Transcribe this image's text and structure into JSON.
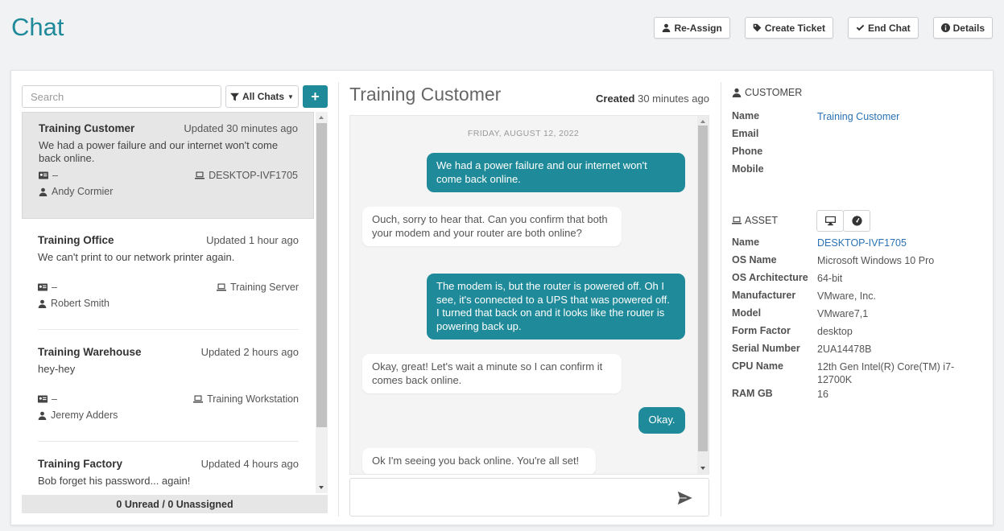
{
  "header": {
    "title": "Chat",
    "actions": [
      {
        "label": "Re-Assign",
        "icon": "user-icon"
      },
      {
        "label": "Create Ticket",
        "icon": "tag-icon"
      },
      {
        "label": "End Chat",
        "icon": "check-icon"
      },
      {
        "label": "Details",
        "icon": "info-icon"
      }
    ]
  },
  "sidebar": {
    "search_placeholder": "Search",
    "filter_label": "All Chats",
    "add_label": "+",
    "chats": [
      {
        "name": "Training Customer",
        "updated": "Updated 30 minutes ago",
        "preview": "We had a power failure and our internet won't come back online.",
        "contact": "–",
        "device": "DESKTOP-IVF1705",
        "user": "Andy Cormier",
        "active": true
      },
      {
        "name": "Training Office",
        "updated": "Updated 1 hour ago",
        "preview": "We can't print to our network printer again.",
        "contact": "–",
        "device": "Training Server",
        "user": "Robert Smith",
        "active": false
      },
      {
        "name": "Training Warehouse",
        "updated": "Updated 2 hours ago",
        "preview": "hey-hey",
        "contact": "–",
        "device": "Training Workstation",
        "user": "Jeremy Adders",
        "active": false
      },
      {
        "name": "Training Factory",
        "updated": "Updated 4 hours ago",
        "preview": "Bob forget his password... again!",
        "contact": "",
        "device": "",
        "user": "",
        "active": false
      }
    ],
    "footer": "0 Unread / 0 Unassigned"
  },
  "conversation": {
    "title": "Training Customer",
    "created_label": "Created",
    "created_value": "30 minutes ago",
    "date": "FRIDAY, AUGUST 12, 2022",
    "messages": [
      {
        "from": "me",
        "text": "We had a power failure and our internet won't come back online."
      },
      {
        "from": "them",
        "text": "Ouch, sorry to hear that. Can you confirm that both your modem and your router are both online?"
      },
      {
        "from": "me",
        "text": "The modem is, but the router is powered off. Oh I see, it's connected to a UPS that was powered off. I turned that back on and it looks like the router is powering back up."
      },
      {
        "from": "them",
        "text": "Okay, great! Let's wait a minute so I can confirm it comes back online."
      },
      {
        "from": "me",
        "text": "Okay."
      },
      {
        "from": "them",
        "text": "Ok I'm seeing you back online. You're all set!"
      }
    ],
    "composer_placeholder": ""
  },
  "details": {
    "customer": {
      "heading": "CUSTOMER",
      "fields": [
        {
          "key": "Name",
          "value": "Training Customer"
        },
        {
          "key": "Email",
          "value": ""
        },
        {
          "key": "Phone",
          "value": ""
        },
        {
          "key": "Mobile",
          "value": ""
        }
      ]
    },
    "asset": {
      "heading": "ASSET",
      "fields": [
        {
          "key": "Name",
          "value": "DESKTOP-IVF1705"
        },
        {
          "key": "OS Name",
          "value": "Microsoft Windows 10 Pro"
        },
        {
          "key": "OS Architecture",
          "value": "64-bit"
        },
        {
          "key": "Manufacturer",
          "value": "VMware, Inc."
        },
        {
          "key": "Model",
          "value": "VMware7,1"
        },
        {
          "key": "Form Factor",
          "value": "desktop"
        },
        {
          "key": "Serial Number",
          "value": "2UA14478B"
        },
        {
          "key": "CPU Name",
          "value": "12th Gen Intel(R) Core(TM) i7-12700K"
        },
        {
          "key": "RAM GB",
          "value": "16"
        }
      ]
    }
  },
  "colors": {
    "accent": "#1f8a99",
    "link": "#2a72b5"
  }
}
